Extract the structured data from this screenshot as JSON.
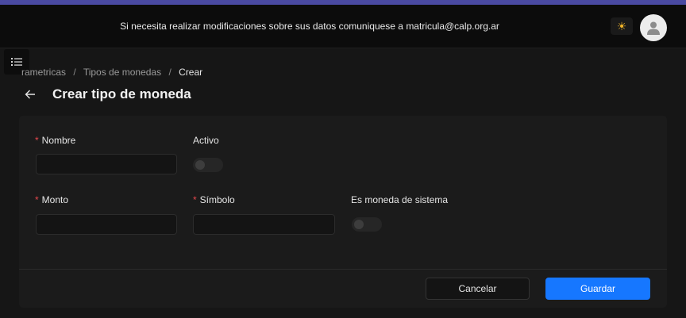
{
  "colors": {
    "accent_bar": "#4a4aa2",
    "primary": "#1677ff",
    "required": "#e5484d",
    "theme_icon": "#f0b429"
  },
  "header": {
    "notice": "Si necesita realizar modificaciones sobre sus datos comuniquese a matricula@calp.org.ar",
    "theme_icon": "sun-icon",
    "avatar_icon": "user-icon"
  },
  "sidebar_toggle": {
    "icon": "list-icon"
  },
  "breadcrumb": {
    "items": [
      "rametricas",
      "Tipos de monedas",
      "Crear"
    ],
    "separator": "/"
  },
  "page": {
    "title": "Crear tipo de moneda",
    "back_icon": "arrow-left-icon"
  },
  "form": {
    "required_mark": "*",
    "nombre": {
      "label": "Nombre",
      "value": "",
      "required": true
    },
    "activo": {
      "label": "Activo",
      "checked": false
    },
    "monto": {
      "label": "Monto",
      "value": "",
      "required": true
    },
    "simbolo": {
      "label": "Símbolo",
      "value": "",
      "required": true
    },
    "es_moneda_sistema": {
      "label": "Es moneda de sistema",
      "checked": false
    }
  },
  "actions": {
    "cancel_label": "Cancelar",
    "save_label": "Guardar"
  }
}
